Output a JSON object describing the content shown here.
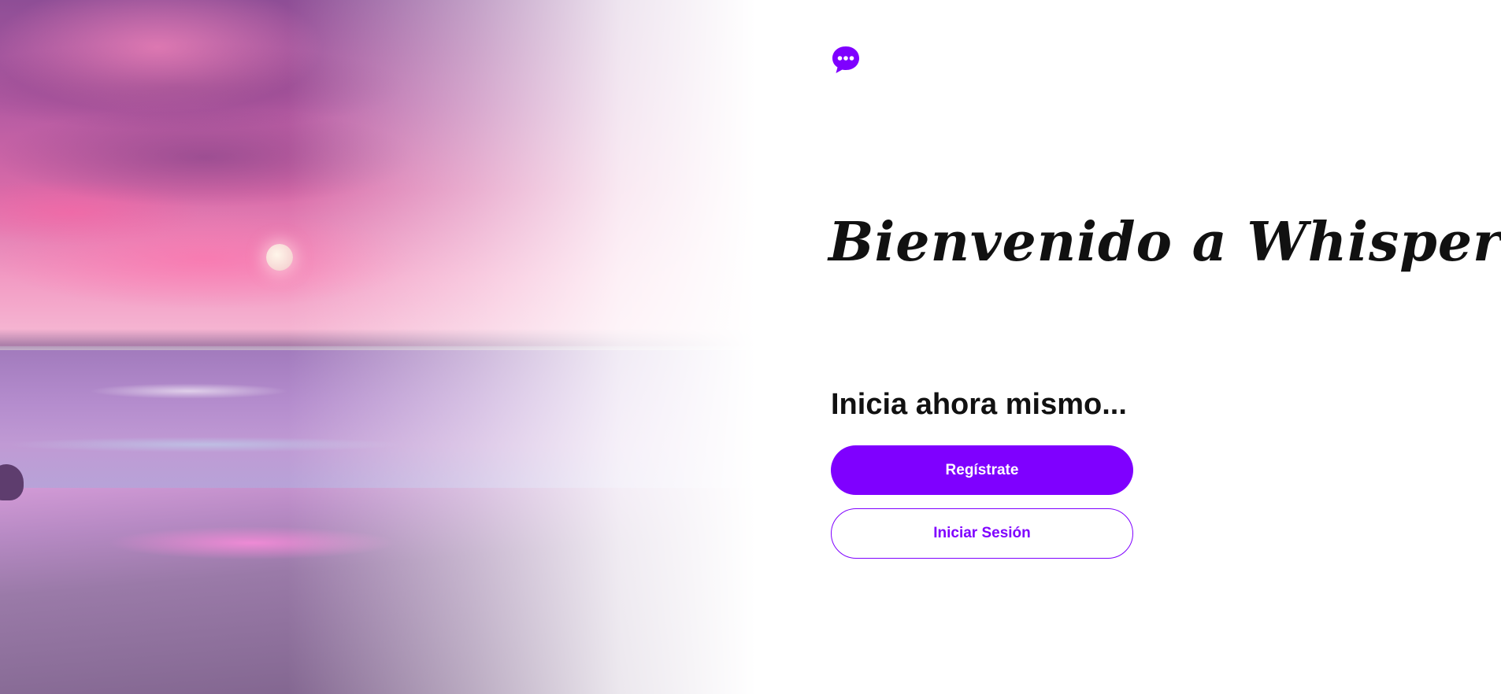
{
  "app": {
    "logo_icon": "chat-bubble-ellipsis-icon",
    "accent_color": "#7f00ff"
  },
  "hero": {
    "image": "sunset-beach-photo",
    "description_colors": [
      "#b35aa2",
      "#f29ac3",
      "#b48ccd"
    ]
  },
  "welcome": {
    "title": "Bienvenido a Whisper",
    "subtitle": "Inicia ahora mismo..."
  },
  "actions": {
    "register_label": "Regístrate",
    "login_label": "Iniciar Sesión"
  }
}
